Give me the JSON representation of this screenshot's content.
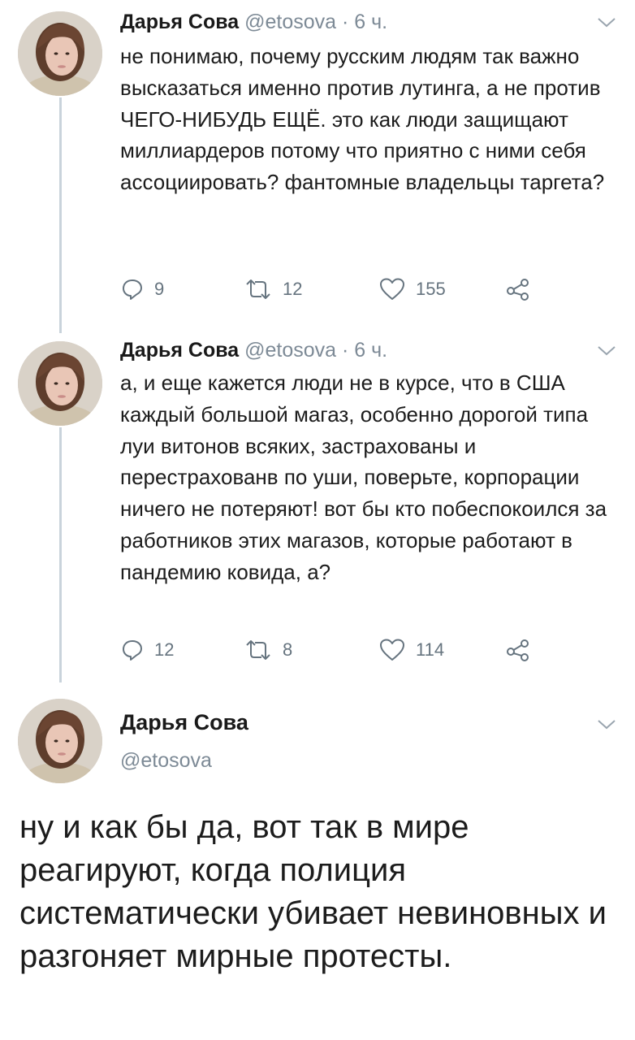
{
  "tweets": [
    {
      "name": "Дарья Сова",
      "meta": "@etosova · 6 ч.",
      "text": "не понимаю, почему русским людям так важно высказаться именно против лутинга, а не против ЧЕГО-НИБУДЬ ЕЩЁ. это как люди защищают миллиардеров потому что приятно с ними себя ассоциировать? фантомные владельцы таргета?",
      "replies": "9",
      "retweets": "12",
      "likes": "155"
    },
    {
      "name": "Дарья Сова",
      "meta": "@etosova · 6 ч.",
      "text": "а, и еще кажется люди не в курсе, что в США каждый большой магаз, особенно дорогой типа луи витонов всяких, застрахованы и перестрахованв по уши, поверьте, корпорации ничего не потеряют! вот бы кто побеспокоился за работников этих магазов, которые работают в пандемию ковида, а?",
      "replies": "12",
      "retweets": "8",
      "likes": "114"
    }
  ],
  "main_tweet": {
    "name": "Дарья Сова",
    "handle": "@etosova",
    "text": "ну и как бы да, вот так в мире реагируют, когда полиция систематически убивает невиновных и разгоняет мирные протесты."
  },
  "icons": {
    "reply": "reply-icon",
    "retweet": "retweet-icon",
    "like": "heart-icon",
    "share": "share-icon",
    "menu": "chevron-down-icon"
  },
  "colors": {
    "thread_line": "#c9d3db",
    "secondary_text": "#7d8a96",
    "icon": "#66747f"
  }
}
